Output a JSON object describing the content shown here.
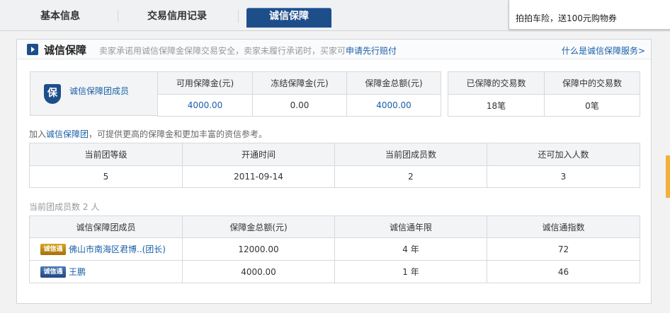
{
  "tabs": [
    {
      "label": "基本信息"
    },
    {
      "label": "交易信用记录"
    },
    {
      "label": "诚信保障"
    }
  ],
  "promo": {
    "text": "拍拍车险，送100元购物券"
  },
  "header": {
    "title": "诚信保障",
    "desc": "卖家承诺用诚信保障金保障交易安全，卖家未履行承诺时，买家可",
    "desc_link": "申请先行赔付",
    "right_link": "什么是诚信保障服务>"
  },
  "guarantee": {
    "member_icon": "保",
    "member_label": "诚信保障团成员",
    "headers": [
      "可用保障金(元)",
      "冻结保障金(元)",
      "保障金总额(元)"
    ],
    "values": [
      "4000.00",
      "0.00",
      "4000.00"
    ]
  },
  "trades": {
    "headers": [
      "已保障的交易数",
      "保障中的交易数"
    ],
    "values": [
      "18笔",
      "0笔"
    ]
  },
  "join": {
    "prefix": "加入",
    "link": "诚信保障团",
    "suffix": "，可提供更高的保障金和更加丰富的资信参考。"
  },
  "group": {
    "headers": [
      "当前团等级",
      "开通时间",
      "当前团成员数",
      "还可加入人数"
    ],
    "values": [
      "5",
      "2011-09-14",
      "2",
      "3"
    ]
  },
  "members_count": "当前团成员数 2 人",
  "members": {
    "headers": [
      "诚信保障团成员",
      "保障金总额(元)",
      "诚信通年限",
      "诚信通指数"
    ],
    "rows": [
      {
        "badge": "诚信通",
        "badge_color": "#c08a16",
        "name": "佛山市南海区君博..(团长)",
        "total": "12000.00",
        "years": "4 年",
        "index": "72"
      },
      {
        "badge": "诚信通",
        "badge_color": "#2f5d9c",
        "name": "王鹏",
        "total": "4000.00",
        "years": "1 年",
        "index": "46"
      }
    ]
  }
}
